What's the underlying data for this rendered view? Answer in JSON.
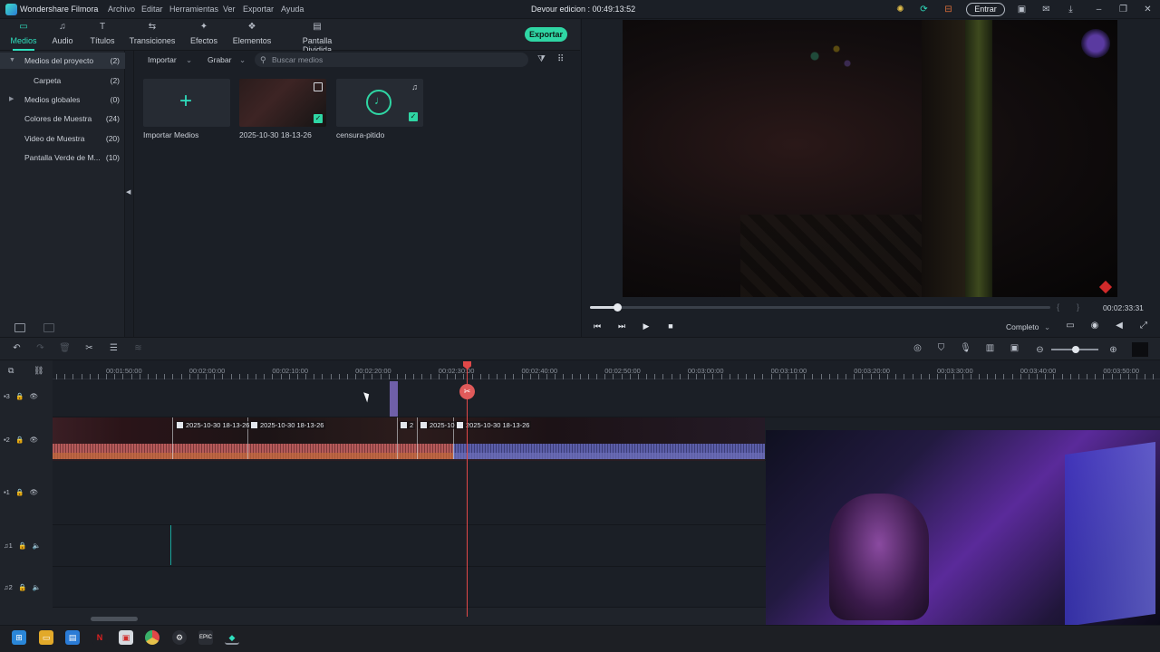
{
  "app": {
    "name": "Wondershare Filmora",
    "menu": [
      "Archivo",
      "Editar",
      "Herramientas",
      "Ver",
      "Exportar",
      "Ayuda"
    ],
    "project_title": "Devour edicion : 00:49:13:52",
    "login_label": "Entrar"
  },
  "tabs": [
    {
      "label": "Medios",
      "icon": "folder-icon",
      "active": true
    },
    {
      "label": "Audio",
      "icon": "music-note-icon",
      "active": false
    },
    {
      "label": "Títulos",
      "icon": "text-t-icon",
      "active": false
    },
    {
      "label": "Transiciones",
      "icon": "transition-icon",
      "active": false
    },
    {
      "label": "Efectos",
      "icon": "effects-icon",
      "active": false
    },
    {
      "label": "Elementos",
      "icon": "elements-icon",
      "active": false
    },
    {
      "label": "Pantalla Dividida",
      "icon": "split-screen-icon",
      "active": false
    }
  ],
  "export_label": "Exportar",
  "sidebar": {
    "items": [
      {
        "label": "Medios del proyecto",
        "count": "(2)",
        "expanded": true
      },
      {
        "label": "Carpeta",
        "count": "(2)"
      },
      {
        "label": "Medios globales",
        "count": "(0)"
      },
      {
        "label": "Colores de Muestra",
        "count": "(24)"
      },
      {
        "label": "Video de Muestra",
        "count": "(20)"
      },
      {
        "label": "Pantalla Verde de M...",
        "count": "(10)"
      }
    ]
  },
  "media": {
    "import_label": "Importar",
    "record_label": "Grabar",
    "search_placeholder": "Buscar medios",
    "items": [
      {
        "caption": "Importar Medios"
      },
      {
        "caption": "2025-10-30 18-13-26"
      },
      {
        "caption": "censura-pitido"
      }
    ]
  },
  "preview": {
    "progress": 0.06,
    "mark_in": "{",
    "mark_out": "}",
    "time": "00:02:33:31",
    "quality": "Completo"
  },
  "timeline": {
    "ruler_labels": [
      "00:01:50:00",
      "00:02:00:00",
      "00:02:10:00",
      "00:02:20:00",
      "00:02:30:00",
      "00:02:40:00",
      "00:02:50:00",
      "00:03:00:00",
      "00:03:10:00",
      "00:03:20:00",
      "00:03:30:00",
      "00:03:40:00",
      "00:03:50:00"
    ],
    "tracks": [
      {
        "id": "3",
        "kind": "video"
      },
      {
        "id": "2",
        "kind": "video"
      },
      {
        "id": "1",
        "kind": "video"
      },
      {
        "id": "1",
        "kind": "audio"
      },
      {
        "id": "2",
        "kind": "audio"
      }
    ],
    "clips": [
      {
        "label": "2025-10-30 18-13-26"
      },
      {
        "label": "2025-10-30 18-13-26"
      },
      {
        "label": "2"
      },
      {
        "label": "2025-10"
      },
      {
        "label": "2025-10-30 18-13-26"
      }
    ],
    "zoom": 0.52
  },
  "taskbar": [
    "windows-start-icon",
    "file-explorer-icon",
    "store-icon",
    "netflix-icon",
    "app-icon",
    "chrome-icon",
    "steam-icon",
    "epic-games-icon",
    "filmora-icon"
  ]
}
